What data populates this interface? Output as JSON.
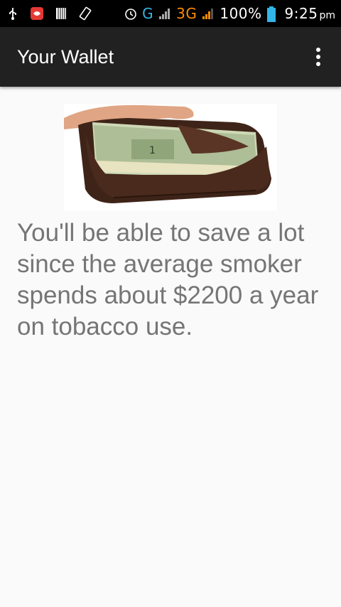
{
  "status_bar": {
    "network_label": "G",
    "network_3g_label": "3G",
    "battery_percent": "100%",
    "time": "9:25",
    "time_suffix": "pm",
    "icons": [
      "usb-icon",
      "app-notification-icon",
      "storage-icon",
      "rotate-icon",
      "alarm-icon",
      "signal-icon",
      "signal-3g-icon",
      "battery-icon"
    ],
    "colors": {
      "network_g": "#33b5e5",
      "network_3g": "#ff8a00",
      "battery": "#33b5e5"
    }
  },
  "app_bar": {
    "title": "Your Wallet",
    "overflow_icon": "more-vert-icon",
    "background": "#212121"
  },
  "main": {
    "image_icon": "wallet-with-cash-image",
    "message": "You'll be able to save a lot since the average smoker spends about $2200 a year on tobacco use."
  }
}
